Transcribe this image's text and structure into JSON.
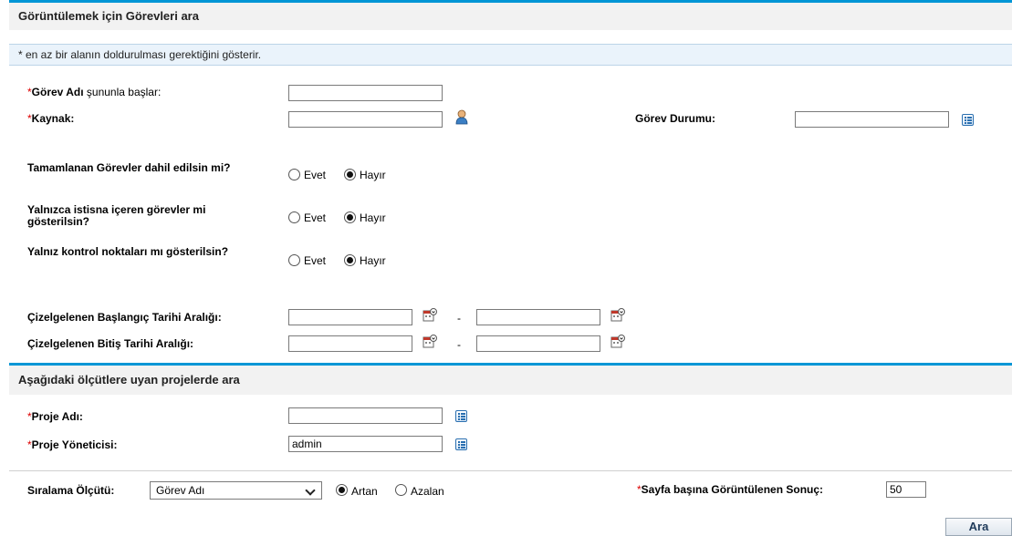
{
  "section1": {
    "title": "Görüntülemek için Görevleri ara",
    "note": "* en az bir alanın doldurulması gerektiğini gösterir.",
    "task_name_prefix": "Görev Adı",
    "task_name_suffix": " şununla başlar:",
    "resource_label": "Kaynak:",
    "task_status_label": "Görev Durumu:",
    "include_completed_label": "Tamamlanan Görevler dahil edilsin mi?",
    "exceptions_label": "Yalnızca istisna içeren görevler mi gösterilsin?",
    "milestones_label": "Yalnız kontrol noktaları mı gösterilsin?",
    "yes": "Evet",
    "no": "Hayır",
    "sched_start_label": "Çizelgelenen Başlangıç Tarihi Aralığı:",
    "sched_end_label": "Çizelgelenen Bitiş Tarihi Aralığı:",
    "dash": "-"
  },
  "section2": {
    "title": "Aşağıdaki ölçütlere uyan projelerde ara",
    "project_name_label": "Proje Adı:",
    "project_manager_label": "Proje Yöneticisi:",
    "project_manager_value": "admin"
  },
  "footer": {
    "sort_label": "Sıralama Ölçütü:",
    "sort_value": "Görev Adı",
    "asc": "Artan",
    "desc": "Azalan",
    "results_label": "Sayfa başına Görüntülenen Sonuç:",
    "results_value": "50",
    "search_button": "Ara"
  },
  "required_mark": "*",
  "colors": {
    "accent": "#0096d6",
    "required": "#dd0000"
  }
}
